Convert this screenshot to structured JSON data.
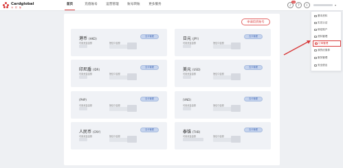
{
  "brand": {
    "name": "Cardglobal",
    "sub": "卡 环 球"
  },
  "nav": [
    "首页",
    "充值账号",
    "运营管理",
    "账号转账",
    "更多服务"
  ],
  "top_icons": {
    "notification_badge": "99"
  },
  "apply_button": "申请用资账号",
  "cards": [
    {
      "name": "港币",
      "code": "(HKD)",
      "btn": "去卡管理",
      "label1": "可用资金金额",
      "label2": "授信中金额"
    },
    {
      "name": "日元",
      "code": "(JPY)",
      "btn": "去卡管理",
      "label1": "可用资金金额",
      "label2": "授信中金额"
    },
    {
      "name": "印尼盾",
      "code": "(IDR)",
      "btn": "去卡管理",
      "label1": "可用资金金额",
      "label2": "授信中金额"
    },
    {
      "name": "美元",
      "code": "(USD)",
      "btn": "去卡管理",
      "label1": "可用资金金额",
      "label2": "授信中金额"
    },
    {
      "name": "",
      "code": "(PHP)",
      "btn": "去卡管理",
      "label1": "可用资金金额",
      "label2": "授信中金额"
    },
    {
      "name": "",
      "code": "(VND)",
      "btn": "去卡管理",
      "label1": "可用资金金额",
      "label2": "授信中金额"
    },
    {
      "name": "人民币",
      "code": "(CNY)",
      "btn": "去卡管理",
      "label1": "可用资金金额",
      "label2": "授信中金额"
    },
    {
      "name": "泰铢",
      "code": "(THB)",
      "btn": "去卡管理",
      "label1": "可用资金金额",
      "label2": "授信中金额"
    }
  ],
  "menu": [
    "基本资料",
    "实名认证",
    "绑定账户",
    "资料管理",
    "订单管理",
    "我的优惠券",
    "服务管理",
    "安全退出"
  ],
  "menu_active_index": 4,
  "colors": {
    "accent": "#d83a3a",
    "card_button": "#c6d4ee"
  }
}
